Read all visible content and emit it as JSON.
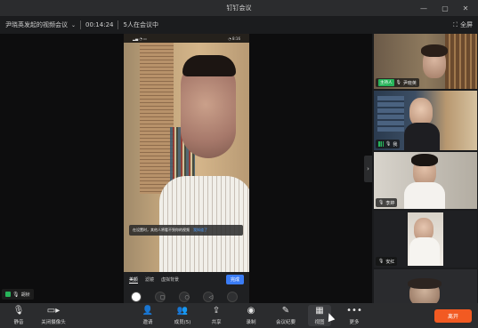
{
  "window": {
    "title": "钉钉会议",
    "controls": [
      "minimize-icon",
      "restore-icon",
      "close-icon"
    ]
  },
  "info": {
    "meeting_name": "尹晓英发起的视频会议",
    "timer": "00:14:24",
    "participants": "5人在会议中",
    "fullscreen_label": "全屏"
  },
  "stage": {
    "phone_status_left": "▂▄ ◔ ▭",
    "phone_status_right": "◔ 8:16",
    "tip_text": "在设置时，其他人将看不到你的视频",
    "tip_link": "我知道了",
    "bg_tabs": [
      {
        "label": "美颜",
        "active": true
      },
      {
        "label": "滤镜",
        "active": false
      },
      {
        "label": "虚拟背景",
        "active": false
      }
    ],
    "done_label": "完成",
    "bg_options": [
      "关闭",
      "美白",
      "磨皮",
      "瘦脸",
      "其他"
    ],
    "presenter_name": "胡桢"
  },
  "sidebar": {
    "tiles": [
      {
        "name": "尹晓英",
        "host": true,
        "host_label": "主持人"
      },
      {
        "name": "我",
        "host": false
      },
      {
        "name": "李婷",
        "host": false
      },
      {
        "name": "安红",
        "host": false
      },
      {
        "name": "",
        "host": false
      }
    ]
  },
  "toolbar": {
    "buttons": [
      {
        "label": "静音",
        "icon": "mic-icon"
      },
      {
        "label": "关闭摄像头",
        "icon": "camera-icon"
      },
      {
        "label": "邀请",
        "icon": "add-user-icon"
      },
      {
        "label": "成员(5)",
        "icon": "members-icon"
      },
      {
        "label": "共享",
        "icon": "share-icon"
      },
      {
        "label": "录制",
        "icon": "record-icon"
      },
      {
        "label": "会议纪要",
        "icon": "minutes-icon"
      },
      {
        "label": "视图",
        "icon": "grid-view-icon"
      },
      {
        "label": "更多",
        "icon": "more-icon"
      }
    ],
    "leave_label": "离开"
  },
  "colors": {
    "accent_green": "#27b35a",
    "leave_orange": "#f25a22",
    "done_blue": "#3a7cf6"
  }
}
